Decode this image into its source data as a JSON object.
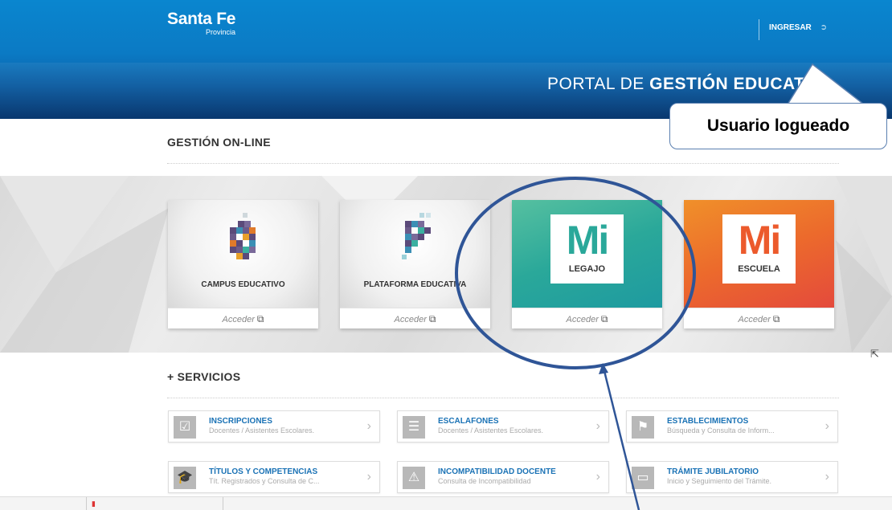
{
  "header": {
    "brand_name": "Santa Fe",
    "brand_sub": "Provincia",
    "login_label": "INGRESAR",
    "login_icon": "login-icon",
    "portal_title_light": "PORTAL DE ",
    "portal_title_bold": "GESTIÓN EDUCAT"
  },
  "callout": {
    "text": "Usuario logueado"
  },
  "online": {
    "title": "GESTIÓN ON-LINE",
    "cards": [
      {
        "label": "CAMPUS EDUCATIVO",
        "access": "Acceder"
      },
      {
        "label": "PLATAFORMA EDUCATIVA",
        "access": "Acceder"
      },
      {
        "mi": "Mi",
        "label": "LEGAJO",
        "access": "Acceder",
        "color": "#2aa89a"
      },
      {
        "mi": "Mi",
        "label": "ESCUELA",
        "access": "Acceder",
        "color": "#ec6a2c"
      }
    ]
  },
  "services": {
    "title": "+ SERVICIOS",
    "items": [
      {
        "title": "INSCRIPCIONES",
        "subtitle": "Docentes / Asistentes Escolares.",
        "icon": "check-icon"
      },
      {
        "title": "ESCALAFONES",
        "subtitle": "Docentes / Asistentes Escolares.",
        "icon": "list-icon"
      },
      {
        "title": "ESTABLECIMIENTOS",
        "subtitle": "Búsqueda y Consulta de Inform...",
        "icon": "flag-icon"
      },
      {
        "title": "TÍTULOS Y COMPETENCIAS",
        "subtitle": "Tít. Registrados y Consulta de C...",
        "icon": "graduation-cap-icon"
      },
      {
        "title": "INCOMPATIBILIDAD DOCENTE",
        "subtitle": "Consulta de Incompatibilidad",
        "icon": "warning-icon"
      },
      {
        "title": "TRÁMITE JUBILATORIO",
        "subtitle": "Inicio y Seguimiento del Trámite.",
        "icon": "archive-icon"
      }
    ]
  },
  "colors": {
    "header_blue": "#0b7ac4",
    "link_blue": "#1a72b5",
    "annotation_blue": "#2f5597"
  }
}
